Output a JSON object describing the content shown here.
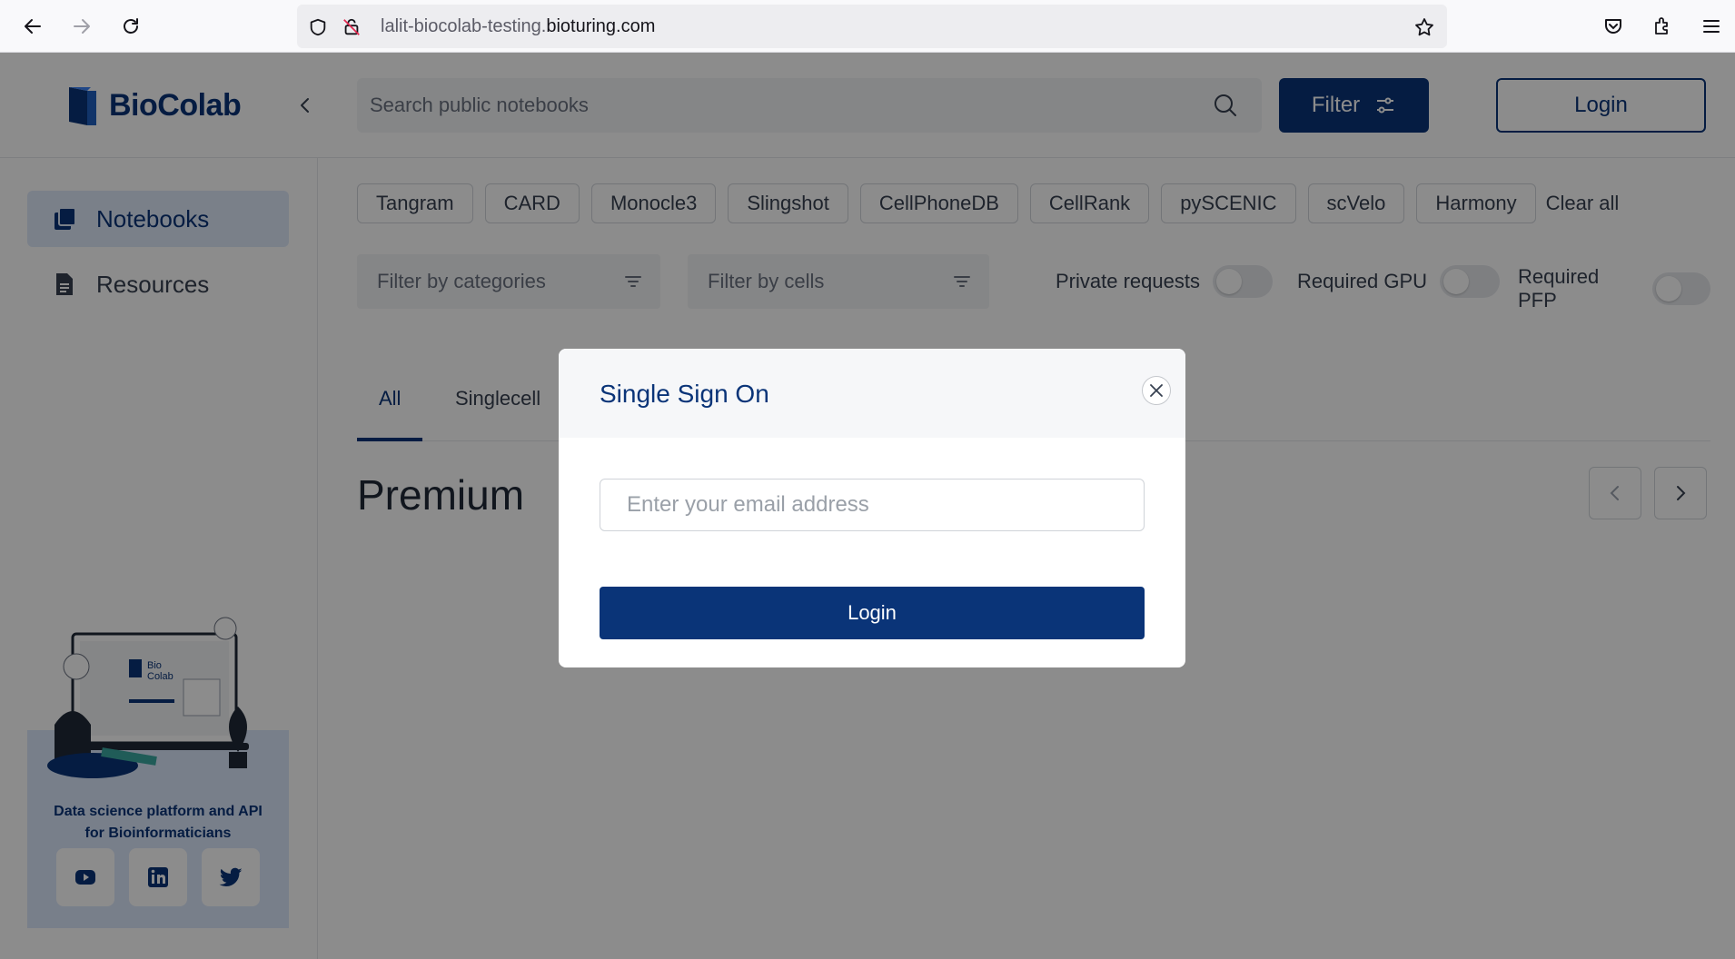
{
  "browser": {
    "url_prefix": "lalit-biocolab-testing.",
    "url_domain": "bioturing.com"
  },
  "header": {
    "brand": "BioColab",
    "search_placeholder": "Search public notebooks",
    "filter_label": "Filter",
    "login_label": "Login"
  },
  "sidebar": {
    "items": [
      {
        "label": "Notebooks",
        "icon": "notebooks-icon",
        "active": true
      },
      {
        "label": "Resources",
        "icon": "document-icon",
        "active": false
      }
    ],
    "promo_tagline_line1": "Data science platform and API",
    "promo_tagline_line2": "for Bioinformaticians",
    "promo_logo_line1": "Bio",
    "promo_logo_line2": "Colab",
    "social": [
      "youtube-icon",
      "linkedin-icon",
      "twitter-icon"
    ]
  },
  "tags": [
    "Tangram",
    "CARD",
    "Monocle3",
    "Slingshot",
    "CellPhoneDB",
    "CellRank",
    "pySCENIC",
    "scVelo",
    "Harmony"
  ],
  "clear_all": "Clear all",
  "filters": {
    "categories_placeholder": "Filter by categories",
    "cells_placeholder": "Filter by cells",
    "toggles": [
      {
        "label": "Private requests",
        "on": false
      },
      {
        "label": "Required GPU",
        "on": false
      },
      {
        "label": "Required PFP",
        "on": false
      }
    ]
  },
  "tabs": [
    {
      "label": "All",
      "active": true
    },
    {
      "label": "Singlecell",
      "active": false
    }
  ],
  "section_title": "Premium",
  "modal": {
    "title": "Single Sign On",
    "email_placeholder": "Enter your email address",
    "login_label": "Login"
  },
  "colors": {
    "brand": "#0a3478",
    "overlay": "rgba(0,0,0,0.45)"
  }
}
